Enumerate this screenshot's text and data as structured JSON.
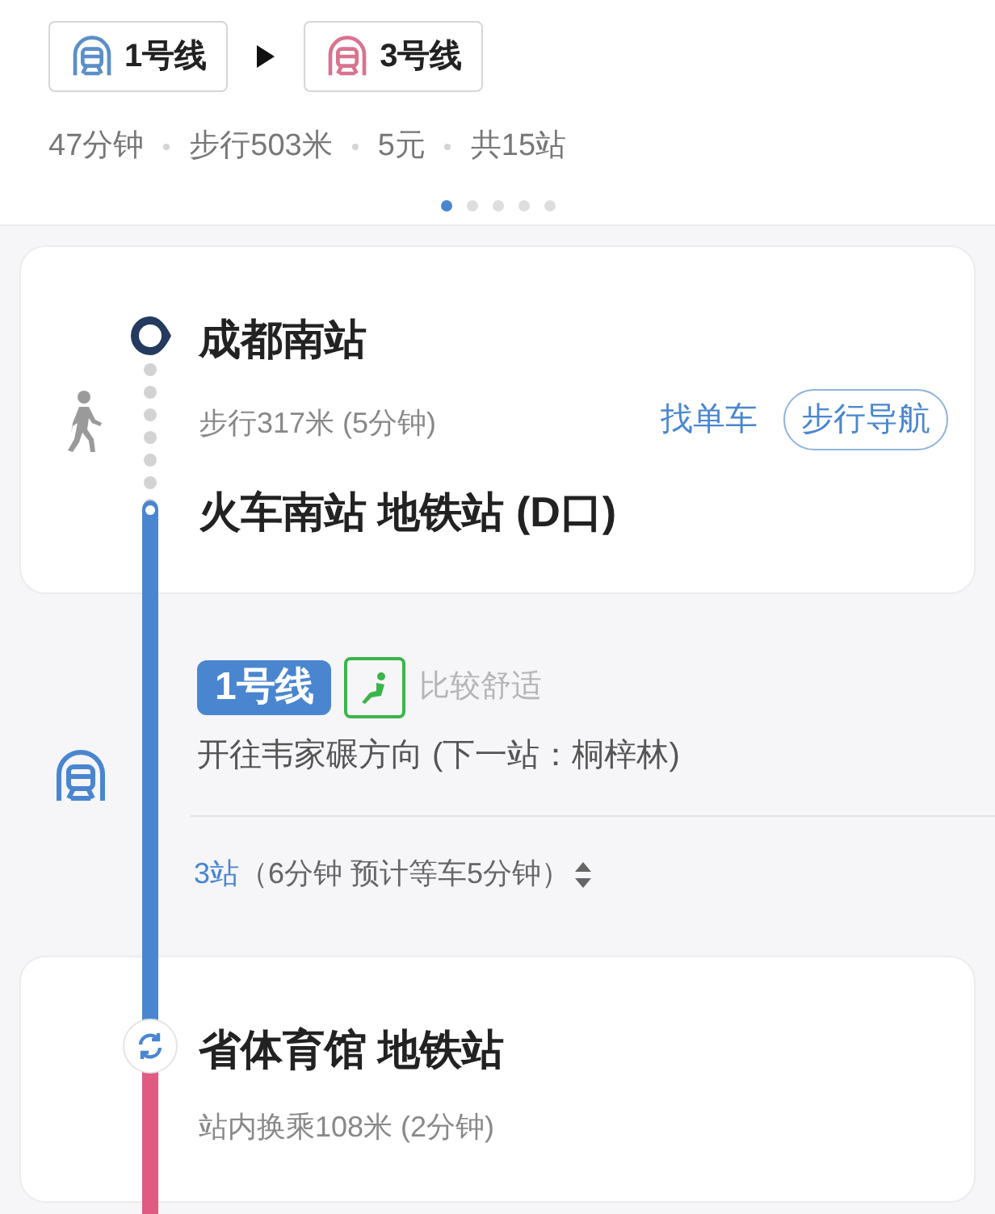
{
  "summary": {
    "lines": [
      {
        "label": "1号线",
        "color": "#5b8fc9"
      },
      {
        "label": "3号线",
        "color": "#d9738f"
      }
    ],
    "stats": [
      "47分钟",
      "步行503米",
      "5元",
      "共15站"
    ],
    "pager": [
      {
        "selected": true
      },
      {
        "selected": false
      },
      {
        "selected": false
      },
      {
        "selected": false
      },
      {
        "selected": false
      }
    ]
  },
  "route": [
    {
      "kind": "walk",
      "from": "成都南站",
      "detail": "步行317米 (5分钟)",
      "actions": [
        {
          "label": "找单车",
          "outlined": false
        },
        {
          "label": "步行导航",
          "outlined": true
        }
      ],
      "to": "火车南站 地铁站 (D口)"
    },
    {
      "kind": "subway",
      "line": "1号线",
      "color": "#4a86d0",
      "comfort": "比较舒适",
      "direction": "开往韦家碾方向 (下一站：桐梓林)",
      "stops": "3站",
      "duration": "（6分钟 预计等车5分钟）"
    },
    {
      "kind": "transfer",
      "station": "省体育馆 地铁站",
      "detail": "站内换乘108米 (2分钟)",
      "color": "#e05a82"
    }
  ]
}
